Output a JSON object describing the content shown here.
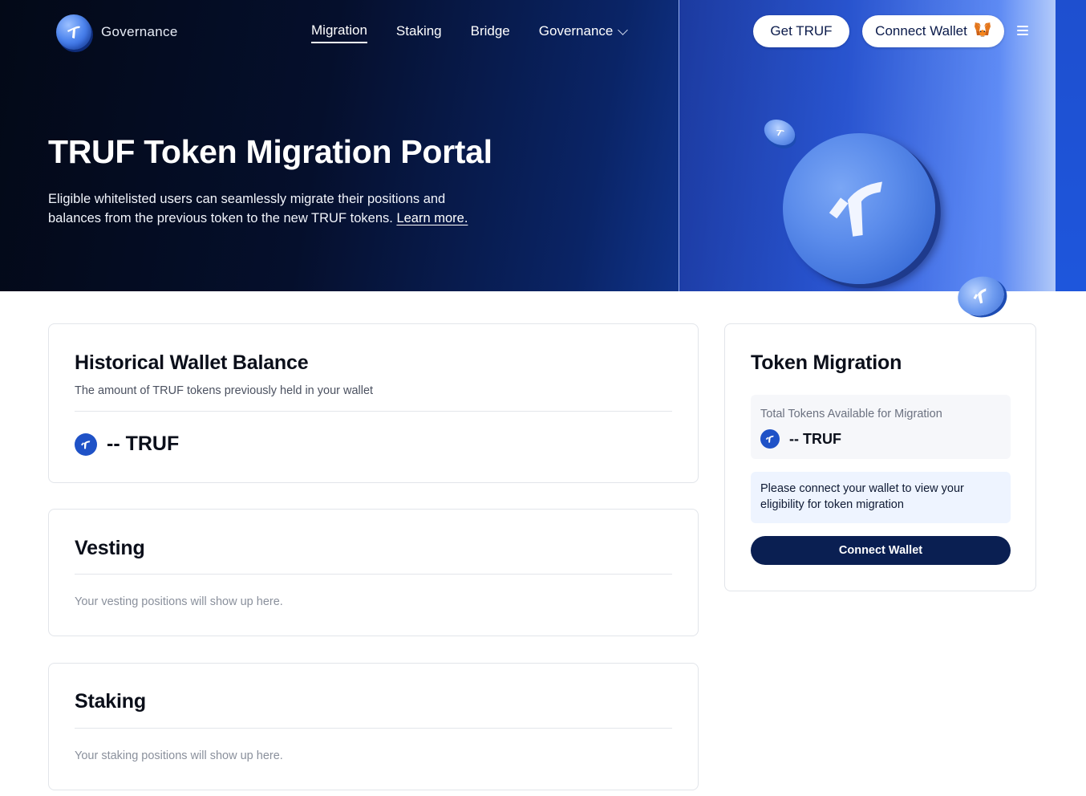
{
  "header": {
    "logo_text": "Governance",
    "nav": [
      {
        "label": "Migration",
        "active": true
      },
      {
        "label": "Staking"
      },
      {
        "label": "Bridge"
      },
      {
        "label": "Governance",
        "has_dropdown": true
      }
    ],
    "get_truf_label": "Get TRUF",
    "connect_wallet_label": "Connect Wallet",
    "wallet_icon": "metamask-fox-icon",
    "menu_icon": "hamburger-menu-icon"
  },
  "hero": {
    "title": "TRUF Token Migration Portal",
    "description": "Eligible whitelisted users can seamlessly migrate their positions and balances from the previous token to the new TRUF tokens.",
    "learn_more": "Learn more."
  },
  "historical": {
    "title": "Historical Wallet Balance",
    "subtitle": "The amount of TRUF tokens previously held in your wallet",
    "balance": "-- TRUF"
  },
  "vesting": {
    "title": "Vesting",
    "empty": "Your vesting positions will show up here."
  },
  "staking": {
    "title": "Staking",
    "empty": "Your staking positions will show up here."
  },
  "migration": {
    "title": "Token Migration",
    "available_label": "Total Tokens Available for Migration",
    "available_value": "-- TRUF",
    "info": "Please connect your wallet to view your eligibility for token migration",
    "connect_button": "Connect Wallet"
  },
  "colors": {
    "accent_navy": "#0a1f52",
    "truf_blue": "#1f52c7",
    "info_bg": "#eef4ff"
  }
}
